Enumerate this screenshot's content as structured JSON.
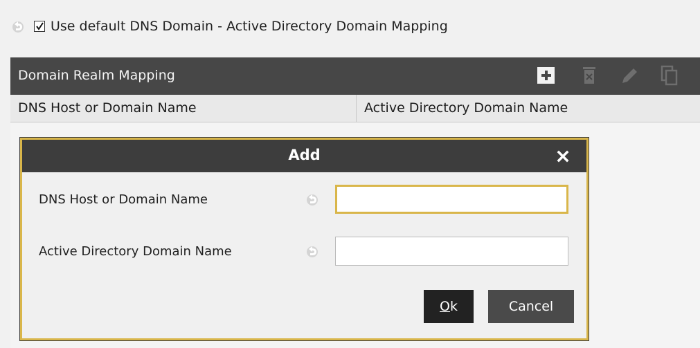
{
  "option": {
    "checkbox_label": "Use default DNS Domain - Active Directory Domain Mapping",
    "checked": true,
    "revert_icon": "revert-icon"
  },
  "panel": {
    "title": "Domain Realm Mapping",
    "tools": [
      {
        "name": "add",
        "icon": "plus-icon"
      },
      {
        "name": "delete",
        "icon": "trash-icon"
      },
      {
        "name": "edit",
        "icon": "pencil-icon"
      },
      {
        "name": "copy",
        "icon": "copy-icon"
      }
    ],
    "columns": [
      "DNS Host or Domain Name",
      "Active Directory Domain Name"
    ],
    "rows": []
  },
  "dialog": {
    "title": "Add",
    "close_icon": "close-icon",
    "fields": [
      {
        "label": "DNS Host or Domain Name",
        "value": ""
      },
      {
        "label": "Active Directory Domain Name",
        "value": ""
      }
    ],
    "ok_prefix": "O",
    "ok_rest": "k",
    "cancel_label": "Cancel"
  },
  "colors": {
    "header_bg": "#474747",
    "dialog_title_bg": "#3d3d3d",
    "accent": "#d9b64a",
    "button_dark": "#222222",
    "button_gray": "#4a4a4a"
  }
}
